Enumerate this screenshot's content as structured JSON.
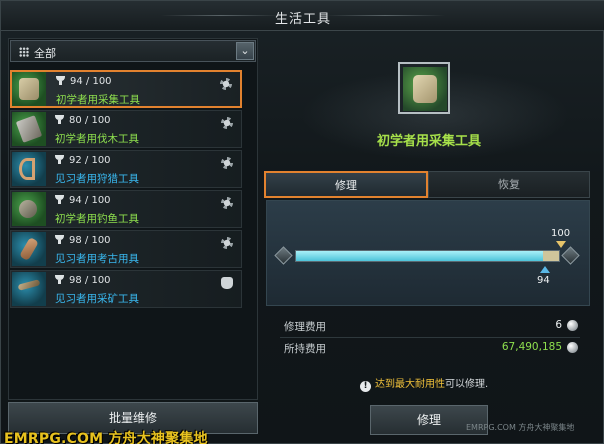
{
  "window": {
    "title": "生活工具"
  },
  "filter": {
    "selected": "全部"
  },
  "tools": [
    {
      "durability": "94 / 100",
      "name": "初学者用采集工具",
      "name_color": "green",
      "icon": "gathering-gloves-icon",
      "status_icon": "gear-icon",
      "rarity": "green",
      "selected": true
    },
    {
      "durability": "80 / 100",
      "name": "初学者用伐木工具",
      "name_color": "green",
      "icon": "logging-axe-icon",
      "status_icon": "gear-icon",
      "rarity": "green",
      "selected": false
    },
    {
      "durability": "92 / 100",
      "name": "见习者用狩猎工具",
      "name_color": "blue",
      "icon": "hunting-bow-icon",
      "status_icon": "gear-icon",
      "rarity": "blue",
      "selected": false
    },
    {
      "durability": "94 / 100",
      "name": "初学者用钓鱼工具",
      "name_color": "green",
      "icon": "fishing-rod-icon",
      "status_icon": "gear-icon",
      "rarity": "green",
      "selected": false
    },
    {
      "durability": "98 / 100",
      "name": "见习者用考古用具",
      "name_color": "blue",
      "icon": "archaeology-shovel-icon",
      "status_icon": "gear-icon",
      "rarity": "blue",
      "selected": false
    },
    {
      "durability": "98 / 100",
      "name": "见习者用采矿工具",
      "name_color": "blue",
      "icon": "mining-pickaxe-icon",
      "status_icon": "bag-icon",
      "rarity": "blue",
      "selected": false
    }
  ],
  "bulk_repair_label": "批量维修",
  "detail": {
    "title": "初学者用采集工具",
    "tabs": [
      {
        "label": "修理",
        "active": true
      },
      {
        "label": "恢复",
        "active": false
      }
    ],
    "durability_current": 94,
    "durability_max": 100,
    "max_label": "100",
    "current_label": "94",
    "repair_cost_label": "修理费用",
    "repair_cost_value": "6",
    "owned_label": "所持费用",
    "owned_value": "67,490,185",
    "notice_highlight": "达到最大耐用性",
    "notice_rest": "可以修理.",
    "repair_button": "修理"
  },
  "colors": {
    "accent_orange": "#e2822f",
    "name_green": "#8ee04e",
    "name_blue": "#39b8ef",
    "owned_value": "#8ee04e",
    "watermark": "#e8c21f"
  },
  "watermark": {
    "main": "EMRPG.COM 方舟大神聚集地",
    "small": "EMRPG.COM 方舟大神聚集地"
  }
}
